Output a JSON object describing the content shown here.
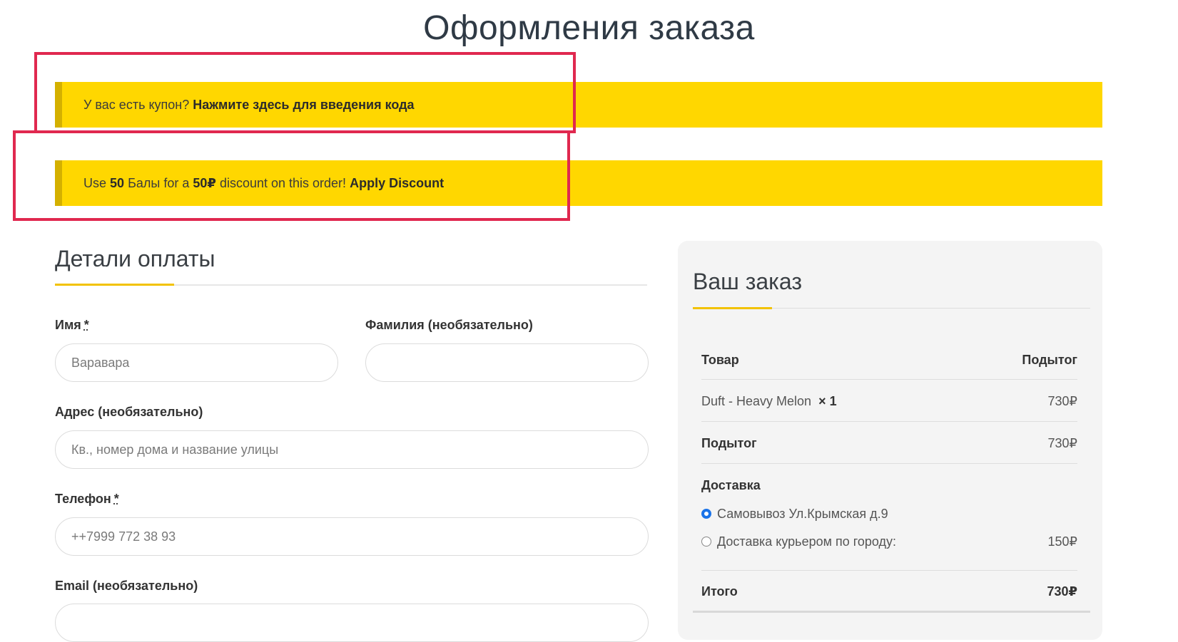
{
  "page": {
    "title": "Оформления заказа"
  },
  "coupon_notice": {
    "text": "У вас есть купон?",
    "link": "Нажмите здесь для введения кода"
  },
  "points_notice": {
    "t1": "Use",
    "points": "50",
    "t2": "Балы for a",
    "amount": "50₽",
    "t3": "discount on this order!",
    "link": "Apply Discount"
  },
  "billing": {
    "title": "Детали оплаты",
    "first_name": {
      "label": "Имя",
      "value": "Варавара"
    },
    "last_name": {
      "label": "Фамилия (необязательно)",
      "value": ""
    },
    "address": {
      "label": "Адрес (необязательно)",
      "placeholder": "Кв., номер дома и название улицы"
    },
    "phone": {
      "label": "Телефон",
      "value": "++7999 772 38 93"
    },
    "email": {
      "label": "Email (необязательно)"
    },
    "required_mark": "*"
  },
  "order": {
    "title": "Ваш заказ",
    "col_product": "Товар",
    "col_subtotal": "Подытог",
    "item_name": "Duft - Heavy Melon",
    "item_qty": "× 1",
    "item_price": "730₽",
    "subtotal_label": "Подытог",
    "subtotal_value": "730₽",
    "shipping_label": "Доставка",
    "shipping_options": [
      {
        "label": "Самовывоз Ул.Крымская д.9",
        "price": "",
        "selected": true
      },
      {
        "label": "Доставка курьером по городу:",
        "price": "150₽",
        "selected": false
      }
    ],
    "total_label": "Итого",
    "total_value": "730₽"
  },
  "colors": {
    "notice": "#ffd700",
    "accent": "#f2c200",
    "highlight": "#e0284f"
  }
}
